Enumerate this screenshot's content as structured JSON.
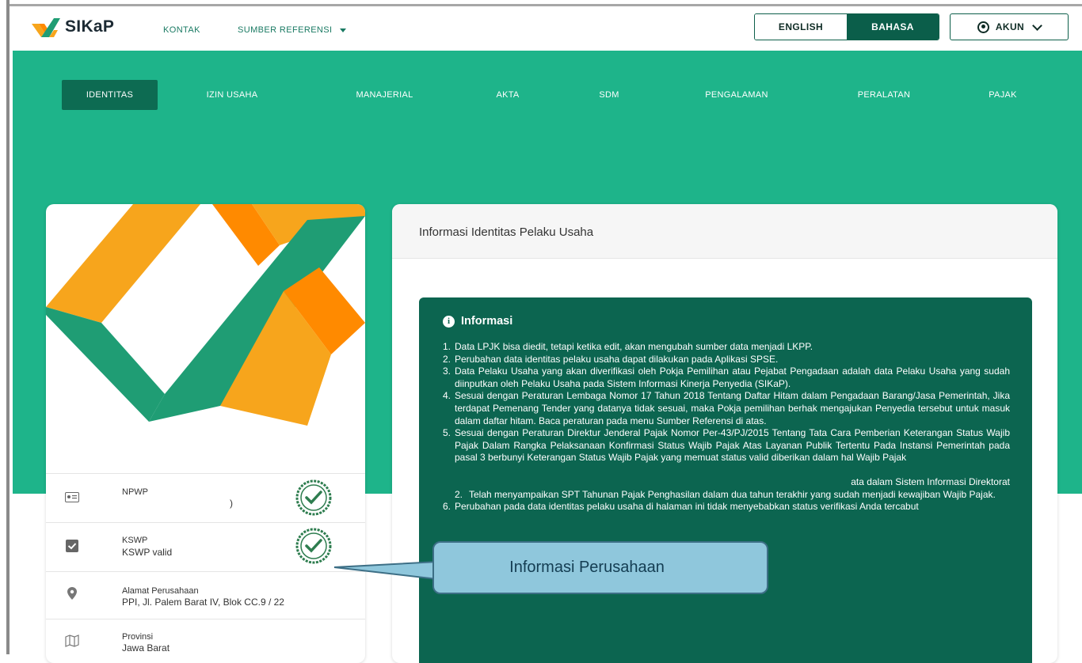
{
  "brand": {
    "name": "SIKaP"
  },
  "nav": {
    "kontak": "KONTAK",
    "sumber": "SUMBER REFERENSI"
  },
  "lang": {
    "english": "ENGLISH",
    "bahasa": "BAHASA"
  },
  "account": {
    "label": "AKUN"
  },
  "tabs": [
    "IDENTITAS",
    "IZIN USAHA",
    "MANAJERIAL",
    "AKTA",
    "SDM",
    "PENGALAMAN",
    "PERALATAN",
    "PAJAK"
  ],
  "active_tab": "IDENTITAS",
  "left_card": {
    "npwp": {
      "title": "NPWP",
      "value": ")"
    },
    "kswp": {
      "title": "KSWP",
      "value": "KSWP valid"
    },
    "alamat": {
      "title": "Alamat Perusahaan",
      "value": "PPI, Jl. Palem Barat IV, Blok CC.9 / 22"
    },
    "provinsi": {
      "title": "Provinsi",
      "value": "Jawa Barat"
    }
  },
  "right_card": {
    "title": "Informasi Identitas Pelaku Usaha",
    "info_heading": "Informasi",
    "items": [
      {
        "num": "1.",
        "text": "Data LPJK bisa diedit, tetapi ketika edit, akan mengubah sumber data menjadi LKPP."
      },
      {
        "num": "2.",
        "text": "Perubahan data identitas pelaku usaha dapat dilakukan pada Aplikasi SPSE."
      },
      {
        "num": "3.",
        "text": "Data Pelaku Usaha yang akan diverifikasi oleh Pokja Pemilihan atau Pejabat Pengadaan adalah data Pelaku Usaha yang sudah diinputkan oleh Pelaku Usaha pada Sistem Informasi Kinerja Penyedia (SIKaP)."
      },
      {
        "num": "4.",
        "text": "Sesuai dengan Peraturan Lembaga Nomor 17 Tahun 2018 Tentang Daftar Hitam dalam Pengadaan Barang/Jasa Pemerintah, Jika terdapat Pemenang Tender yang datanya tidak sesuai, maka Pokja pemilihan berhak mengajukan Penyedia tersebut untuk masuk dalam daftar hitam. Baca peraturan pada menu Sumber Referensi di atas."
      },
      {
        "num": "5.",
        "text": "Sesuai dengan Peraturan Direktur Jenderal Pajak Nomor Per-43/PJ/2015 Tentang Tata Cara Pemberian Keterangan Status Wajib Pajak Dalam Rangka Pelaksanaan Konfirmasi Status Wajib Pajak Atas Layanan Publik Tertentu Pada Instansi Pemerintah pada pasal 3 berbunyi Keterangan Status Wajib Pajak yang memuat status valid diberikan dalam hal Wajib Pajak"
      }
    ],
    "sub_items": [
      {
        "num": "",
        "text": "ata dalam Sistem Informasi Direktorat"
      },
      {
        "num": "2.",
        "text": "Telah menyampaikan SPT Tahunan Pajak Penghasilan dalam dua tahun terakhir yang sudah menjadi kewajiban Wajib Pajak."
      }
    ],
    "item6": {
      "num": "6.",
      "text": "Perubahan pada data identitas pelaku usaha di halaman ini tidak menyebabkan status verifikasi Anda tercabut"
    }
  },
  "callout": {
    "text": "Informasi Perusahaan"
  },
  "colors": {
    "primary": "#1eb48a",
    "dark_green": "#0c6550",
    "orange": "#f7a51c",
    "callout_bg": "#8fc7dc"
  }
}
